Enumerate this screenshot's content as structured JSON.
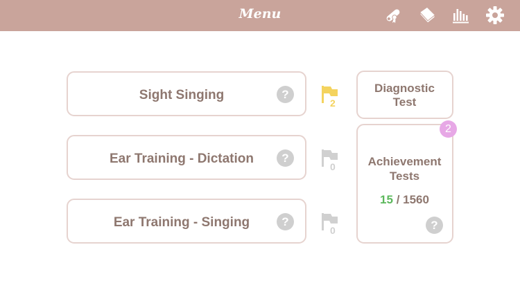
{
  "header": {
    "title": "Menu"
  },
  "modes": [
    {
      "label": "Sight Singing",
      "help": "?",
      "flag_count": "2"
    },
    {
      "label": "Ear Training - Dictation",
      "help": "?",
      "flag_count": "0"
    },
    {
      "label": "Ear Training - Singing",
      "help": "?",
      "flag_count": "0"
    }
  ],
  "diagnostic": {
    "line1": "Diagnostic",
    "line2": "Test"
  },
  "achievement": {
    "badge": "2",
    "line1": "Achievement",
    "line2": "Tests",
    "completed": "15",
    "total": "/ 1560",
    "help": "?"
  },
  "colors": {
    "header_bg": "#c9a49b",
    "flag_active": "#f4d35e",
    "flag_inactive": "#d0d0d0",
    "completed_green": "#5cb85c",
    "badge_pink": "#e7a8e6"
  },
  "icons": [
    "diploma-icon",
    "book-icon",
    "stats-icon",
    "gear-icon",
    "flag-icon",
    "help-icon"
  ]
}
